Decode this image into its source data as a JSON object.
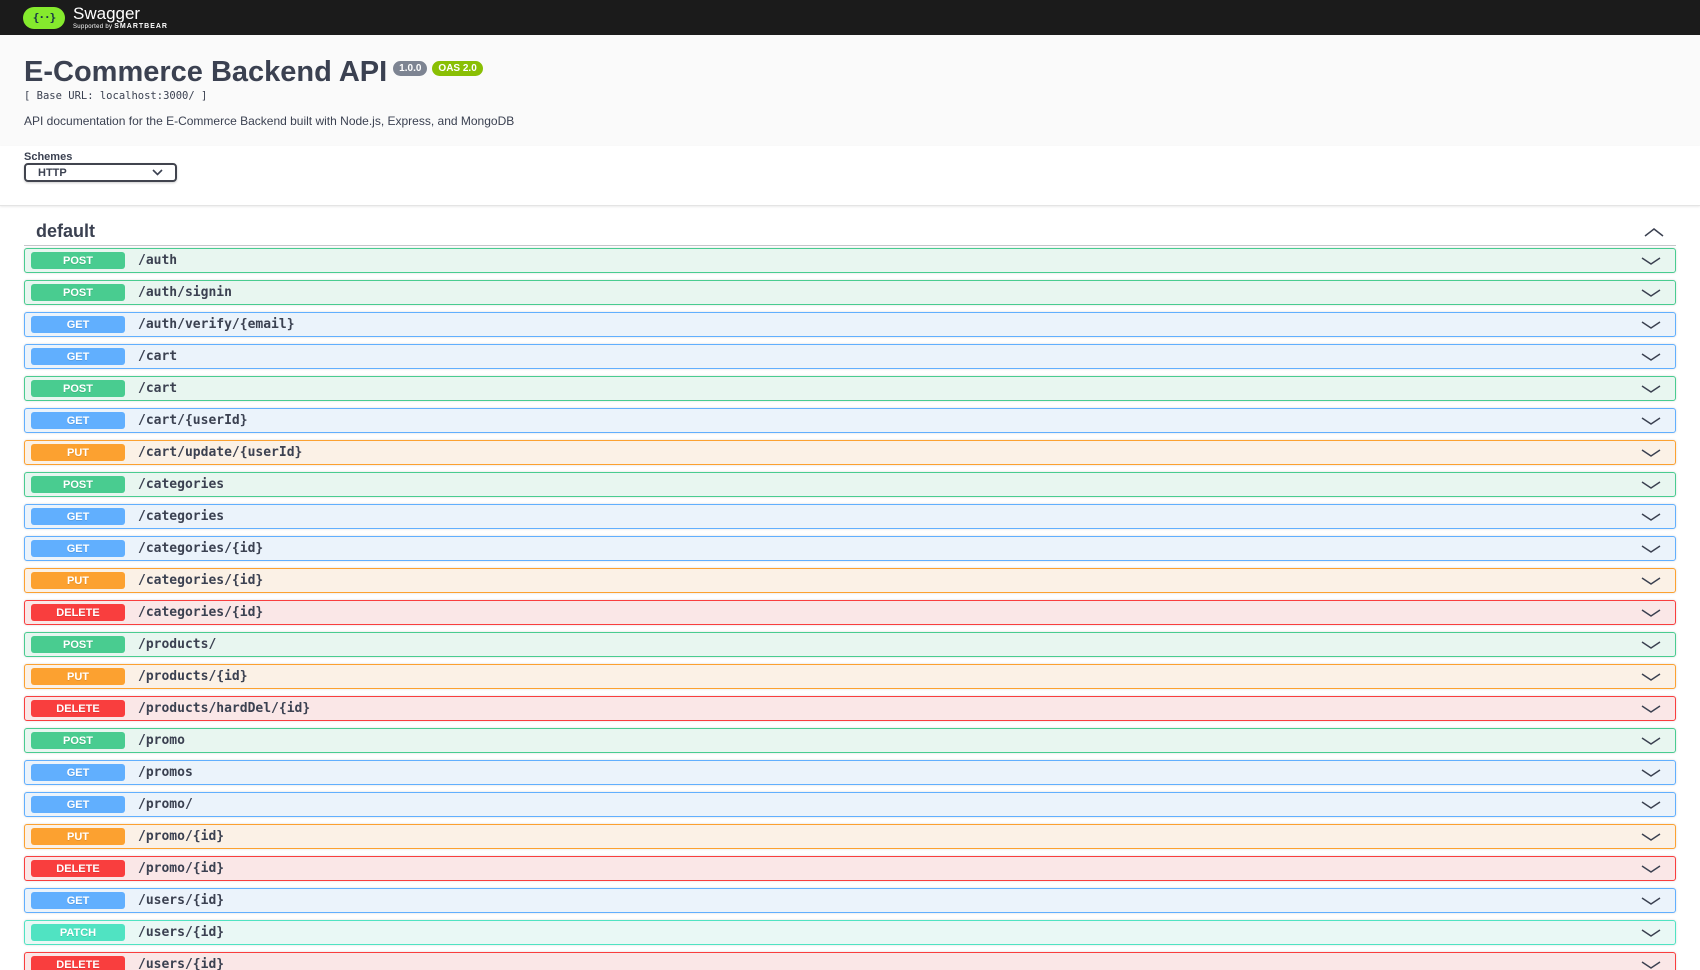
{
  "topbar": {
    "logo_icon": "swagger-braces-icon",
    "logo_glyph": "{··}",
    "brand": "Swagger",
    "supported_by": "Supported by",
    "smartbear": "SMARTBEAR"
  },
  "info": {
    "title": "E-Commerce Backend API",
    "version": "1.0.0",
    "oas": "OAS 2.0",
    "base_url": "[ Base URL: localhost:3000/ ]",
    "description": "API documentation for the E-Commerce Backend built with Node.js, Express, and MongoDB"
  },
  "schemes": {
    "label": "Schemes",
    "selected": "HTTP"
  },
  "section": {
    "title": "default"
  },
  "colors": {
    "post": "#49cc90",
    "get": "#61affe",
    "put": "#fca130",
    "delete": "#f93e3e",
    "patch": "#50e3c2"
  },
  "operations": [
    {
      "method": "POST",
      "path": "/auth"
    },
    {
      "method": "POST",
      "path": "/auth/signin"
    },
    {
      "method": "GET",
      "path": "/auth/verify/{email}"
    },
    {
      "method": "GET",
      "path": "/cart"
    },
    {
      "method": "POST",
      "path": "/cart"
    },
    {
      "method": "GET",
      "path": "/cart/{userId}"
    },
    {
      "method": "PUT",
      "path": "/cart/update/{userId}"
    },
    {
      "method": "POST",
      "path": "/categories"
    },
    {
      "method": "GET",
      "path": "/categories"
    },
    {
      "method": "GET",
      "path": "/categories/{id}"
    },
    {
      "method": "PUT",
      "path": "/categories/{id}"
    },
    {
      "method": "DELETE",
      "path": "/categories/{id}"
    },
    {
      "method": "POST",
      "path": "/products/"
    },
    {
      "method": "PUT",
      "path": "/products/{id}"
    },
    {
      "method": "DELETE",
      "path": "/products/hardDel/{id}"
    },
    {
      "method": "POST",
      "path": "/promo"
    },
    {
      "method": "GET",
      "path": "/promos"
    },
    {
      "method": "GET",
      "path": "/promo/"
    },
    {
      "method": "PUT",
      "path": "/promo/{id}"
    },
    {
      "method": "DELETE",
      "path": "/promo/{id}"
    },
    {
      "method": "GET",
      "path": "/users/{id}"
    },
    {
      "method": "PATCH",
      "path": "/users/{id}"
    },
    {
      "method": "DELETE",
      "path": "/users/{id}"
    }
  ]
}
